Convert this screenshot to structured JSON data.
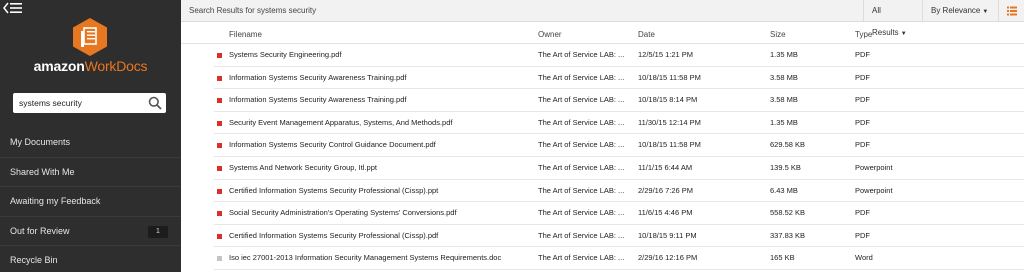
{
  "sidebar": {
    "logo": {
      "brand": "amazon",
      "product": "WorkDocs"
    },
    "search": {
      "value": "systems security"
    },
    "nav": [
      {
        "label": "My Documents"
      },
      {
        "label": "Shared With Me"
      },
      {
        "label": "Awaiting my Feedback"
      },
      {
        "label": "Out for Review",
        "badge": "1"
      },
      {
        "label": "Recycle Bin"
      }
    ]
  },
  "topbar": {
    "title": "Search Results for systems security",
    "filter_label": "All Results",
    "sort_label": "By Relevance"
  },
  "table": {
    "columns": {
      "filename": "Filename",
      "owner": "Owner",
      "date": "Date",
      "size": "Size",
      "type": "Type"
    },
    "rows": [
      {
        "icon": "pdf-icon",
        "filename": "Systems Security Engineering.pdf",
        "owner": "The Art of Service LAB: ...",
        "date": "12/5/15 1:21 PM",
        "size": "1.35 MB",
        "type": "PDF"
      },
      {
        "icon": "pdf-icon",
        "filename": "Information Systems Security Awareness Training.pdf",
        "owner": "The Art of Service LAB: ...",
        "date": "10/18/15 11:58 PM",
        "size": "3.58 MB",
        "type": "PDF"
      },
      {
        "icon": "pdf-icon",
        "filename": "Information Systems Security Awareness Training.pdf",
        "owner": "The Art of Service LAB: ...",
        "date": "10/18/15 8:14 PM",
        "size": "3.58 MB",
        "type": "PDF"
      },
      {
        "icon": "pdf-icon",
        "filename": "Security Event Management Apparatus, Systems, And Methods.pdf",
        "owner": "The Art of Service LAB: ...",
        "date": "11/30/15 12:14 PM",
        "size": "1.35 MB",
        "type": "PDF"
      },
      {
        "icon": "pdf-icon",
        "filename": "Information Systems Security Control Guidance Document.pdf",
        "owner": "The Art of Service LAB: ...",
        "date": "10/18/15 11:58 PM",
        "size": "629.58 KB",
        "type": "PDF"
      },
      {
        "icon": "ppt-icon",
        "filename": "Systems And Network Security Group, Itl.ppt",
        "owner": "The Art of Service LAB: ...",
        "date": "11/1/15 6:44 AM",
        "size": "139.5 KB",
        "type": "Powerpoint"
      },
      {
        "icon": "ppt-icon",
        "filename": "Certified Information Systems Security Professional (Cissp).ppt",
        "owner": "The Art of Service LAB: ...",
        "date": "2/29/16 7:26 PM",
        "size": "6.43 MB",
        "type": "Powerpoint"
      },
      {
        "icon": "pdf-icon",
        "filename": "Social Security Administration's Operating Systems' Conversions.pdf",
        "owner": "The Art of Service LAB: ...",
        "date": "11/6/15 4:46 PM",
        "size": "558.52 KB",
        "type": "PDF"
      },
      {
        "icon": "pdf-icon",
        "filename": "Certified Information Systems Security Professional (Cissp).pdf",
        "owner": "The Art of Service LAB: ...",
        "date": "10/18/15 9:11 PM",
        "size": "337.83 KB",
        "type": "PDF"
      },
      {
        "icon": "doc-icon",
        "filename": "Iso iec 27001-2013 Information Security Management Systems Requirements.doc",
        "owner": "The Art of Service LAB: ...",
        "date": "2/29/16 12:16 PM",
        "size": "165 KB",
        "type": "Word"
      }
    ]
  },
  "colors": {
    "sidebar_bg": "#2e2e2e",
    "accent": "#e87722",
    "pdf_icon": "#d9302c"
  }
}
